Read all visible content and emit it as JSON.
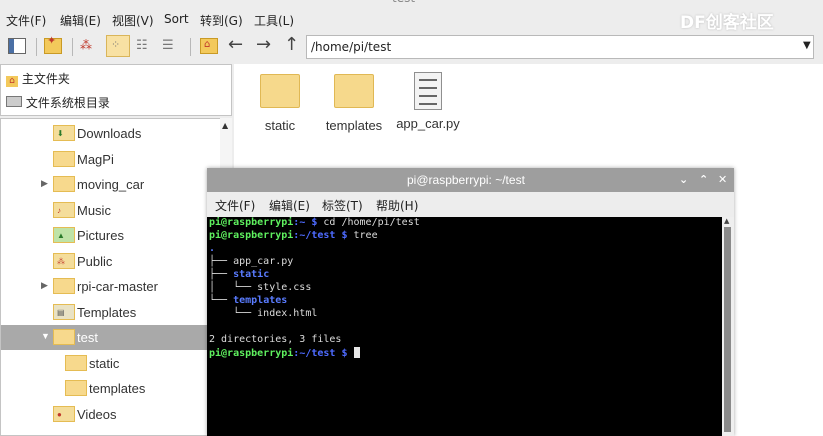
{
  "window": {
    "title": "test"
  },
  "menu": [
    "文件(F)",
    "编辑(E)",
    "视图(V)",
    "Sort",
    "转到(G)",
    "工具(L)"
  ],
  "path": {
    "value": "/home/pi/test"
  },
  "places": [
    "主文件夹",
    "文件系统根目录"
  ],
  "tree": [
    {
      "label": "Downloads",
      "expander": "",
      "icon": "download"
    },
    {
      "label": "MagPi",
      "expander": "",
      "icon": ""
    },
    {
      "label": "moving_car",
      "expander": "▶",
      "icon": ""
    },
    {
      "label": "Music",
      "expander": "",
      "icon": "music"
    },
    {
      "label": "Pictures",
      "expander": "",
      "icon": "picture"
    },
    {
      "label": "Public",
      "expander": "",
      "icon": "share"
    },
    {
      "label": "rpi-car-master",
      "expander": "▶",
      "icon": ""
    },
    {
      "label": "Templates",
      "expander": "",
      "icon": "template"
    },
    {
      "label": "test",
      "expander": "▼",
      "icon": ""
    },
    {
      "label": "static",
      "expander": "",
      "icon": ""
    },
    {
      "label": "templates",
      "expander": "",
      "icon": ""
    },
    {
      "label": "Videos",
      "expander": "",
      "icon": "video"
    }
  ],
  "files": [
    {
      "name": "static",
      "kind": "folder"
    },
    {
      "name": "templates",
      "kind": "folder"
    },
    {
      "name": "app_car.py",
      "kind": "file"
    }
  ],
  "watermark": "DF创客社区",
  "terminal": {
    "title": "pi@raspberrypi: ~/test",
    "menu": [
      "文件(F)",
      "编辑(E)",
      "标签(T)",
      "帮助(H)"
    ],
    "prompt_home": "pi@raspberrypi",
    "path_home": ":~ $",
    "cmd1": " cd /home/pi/test",
    "prompt2": "pi@raspberrypi",
    "path_test": ":~/test $",
    "cmd2": " tree",
    "dot": ".",
    "tree1": "├── app_car.py",
    "tree2_pre": "├── ",
    "tree2": "static",
    "tree3": "│   └── style.css",
    "tree4_pre": "└── ",
    "tree4": "templates",
    "tree5": "    └── index.html",
    "summary": "2 directories, 3 files",
    "prompt3": "pi@raspberrypi",
    "path3": ":~/test $"
  },
  "colors": {
    "prompt": "#5ff05f",
    "dir": "#5a7cff",
    "folder": "#f7d98d",
    "selection": "#a9a9a9"
  }
}
